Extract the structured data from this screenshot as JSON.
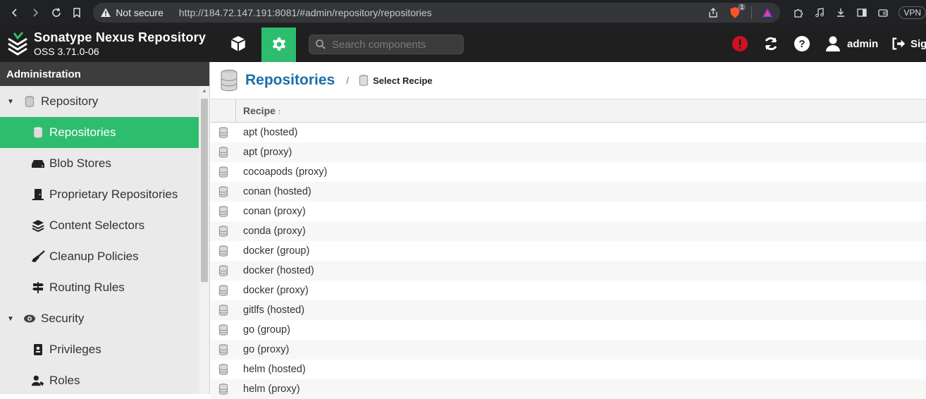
{
  "browser": {
    "security_label": "Not secure",
    "url": "http://184.72.147.191:8081/#admin/repository/repositories",
    "brave_badge_count": "1",
    "vpn_label": "VPN"
  },
  "header": {
    "brand_title": "Sonatype Nexus Repository",
    "brand_version": "OSS 3.71.0-06",
    "search_placeholder": "Search components",
    "user_label": "admin",
    "signout_label": "Sig"
  },
  "sidebar": {
    "title": "Administration",
    "items": [
      {
        "label": "Repository",
        "icon": "database-icon",
        "type": "group"
      },
      {
        "label": "Repositories",
        "icon": "database-icon",
        "type": "child",
        "active": true
      },
      {
        "label": "Blob Stores",
        "icon": "drive-icon",
        "type": "child"
      },
      {
        "label": "Proprietary Repositories",
        "icon": "door-icon",
        "type": "child"
      },
      {
        "label": "Content Selectors",
        "icon": "layers-icon",
        "type": "child"
      },
      {
        "label": "Cleanup Policies",
        "icon": "broom-icon",
        "type": "child"
      },
      {
        "label": "Routing Rules",
        "icon": "signpost-icon",
        "type": "child"
      },
      {
        "label": "Security",
        "icon": "eye-icon",
        "type": "group"
      },
      {
        "label": "Privileges",
        "icon": "id-badge-icon",
        "type": "child"
      },
      {
        "label": "Roles",
        "icon": "user-roles-icon",
        "type": "child"
      }
    ]
  },
  "main": {
    "title": "Repositories",
    "separator": "/",
    "subtitle": "Select Recipe",
    "column_header": "Recipe",
    "sort_indicator": "↑",
    "recipes": [
      "apt (hosted)",
      "apt (proxy)",
      "cocoapods (proxy)",
      "conan (hosted)",
      "conan (proxy)",
      "conda (proxy)",
      "docker (group)",
      "docker (hosted)",
      "docker (proxy)",
      "gitlfs (hosted)",
      "go (group)",
      "go (proxy)",
      "helm (hosted)",
      "helm (proxy)"
    ]
  },
  "colors": {
    "accent_green": "#2ebd6e",
    "link_blue": "#1a6fa8",
    "header_bg": "#1f1f1f",
    "alert_red": "#d0111f"
  }
}
